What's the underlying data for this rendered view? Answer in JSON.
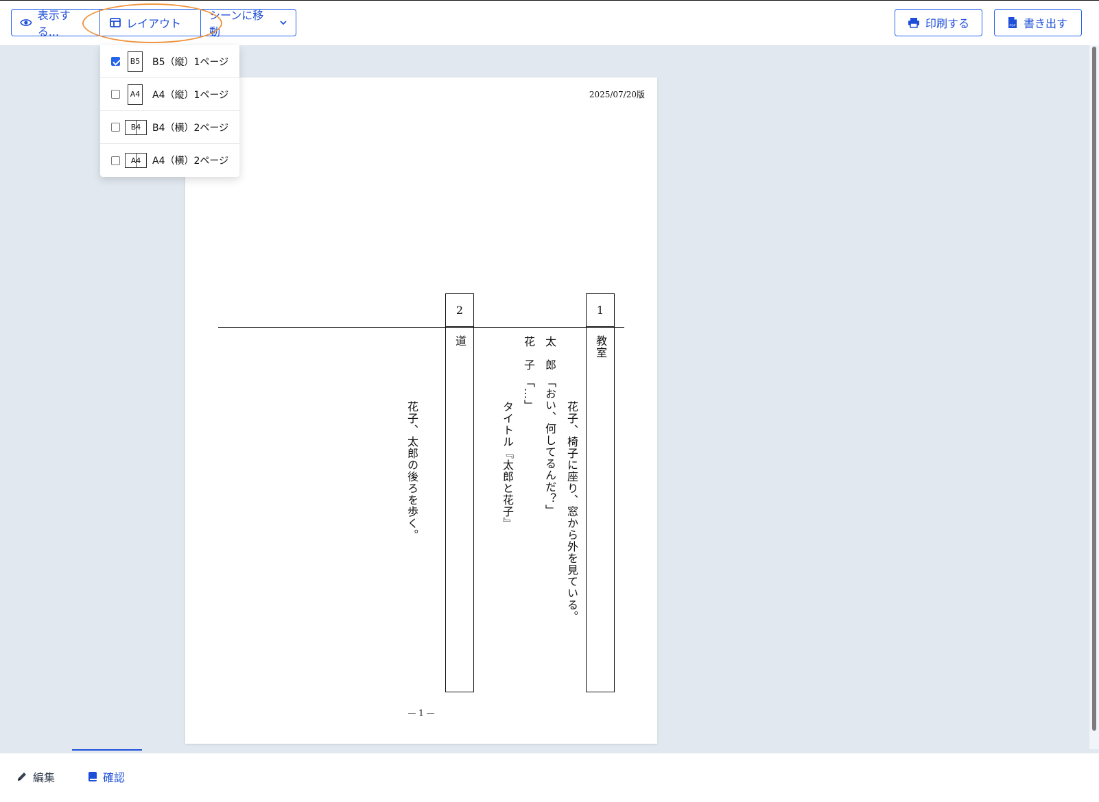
{
  "toolbar": {
    "show_label": "表示する...",
    "layout_label": "レイアウト",
    "scene_jump_label": "シーンに移動",
    "print_label": "印刷する",
    "export_label": "書き出す"
  },
  "layout_menu": {
    "items": [
      {
        "icon_text": "B5",
        "label": "B5（縦）1ページ",
        "checked": true,
        "orientation": "portrait"
      },
      {
        "icon_text": "A4",
        "label": "A4（縦）1ページ",
        "checked": false,
        "orientation": "portrait"
      },
      {
        "icon_text": "B4",
        "label": "B4（横）2ページ",
        "checked": false,
        "orientation": "landscape"
      },
      {
        "icon_text": "A4",
        "label": "A4（横）2ページ",
        "checked": false,
        "orientation": "landscape"
      }
    ]
  },
  "page": {
    "date": "2025/07/20版",
    "page_number": "— 1 —",
    "scenes": [
      {
        "number": "1",
        "place": "教室"
      },
      {
        "number": "2",
        "place": "道"
      }
    ],
    "lines": {
      "action1": "花子、椅子に座り、窓から外を見ている。",
      "taro_name": "太　郎",
      "taro_line": "「おい、何してるんだ？」",
      "hanako_name": "花　子",
      "hanako_line": "「…」",
      "title_line": "タイトル『太郎と花子』",
      "action2": "花子、太郎の後ろを歩く。"
    }
  },
  "tabs": {
    "edit_label": "編集",
    "confirm_label": "確認"
  },
  "colors": {
    "accent": "#1d4ed8",
    "viewer_bg": "#e2e8f0",
    "highlight": "#f0953f"
  }
}
